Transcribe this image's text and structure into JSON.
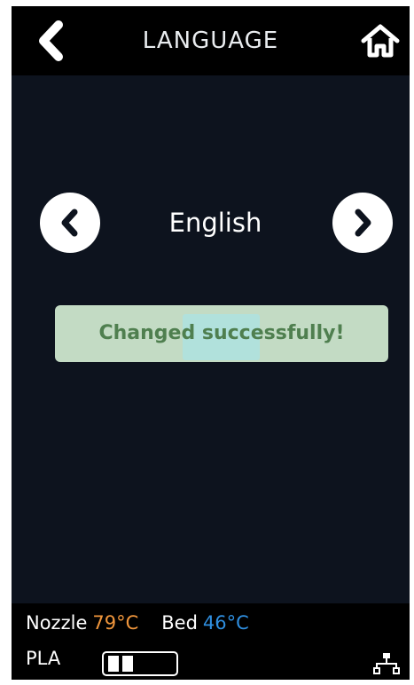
{
  "header": {
    "title": "LANGUAGE",
    "back_icon": "chevron-left-icon",
    "home_icon": "home-icon"
  },
  "language": {
    "current": "English",
    "prev_icon": "chevron-left-circle-icon",
    "next_icon": "chevron-right-circle-icon"
  },
  "toast": {
    "message": "Changed successfully!"
  },
  "status": {
    "nozzle_label": "Nozzle",
    "nozzle_temp": "79°C",
    "bed_label": "Bed",
    "bed_temp": "46°C",
    "filament_label": "PLA",
    "filament_level_fraction": 0.33,
    "network_icon": "network-icon"
  },
  "colors": {
    "background": "#0d131e",
    "bar": "#000000",
    "nozzle_temp": "#f0963c",
    "bed_temp": "#2f8fe0",
    "toast_bg": "#c3dbc4",
    "toast_text": "#4f7f4f"
  }
}
